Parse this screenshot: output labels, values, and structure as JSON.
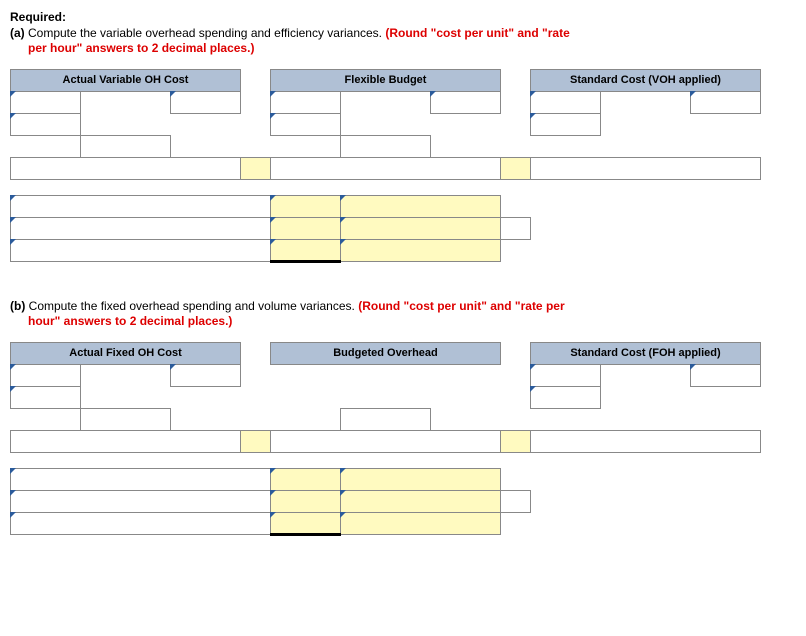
{
  "required_label": "Required:",
  "partA": {
    "marker": "(a) ",
    "text_main": "Compute the variable overhead spending and efficiency variances. ",
    "text_red1": "(Round \"cost per unit\" and \"rate",
    "text_red2": "per hour\" answers to 2 decimal places.)",
    "headers": {
      "col1": "Actual Variable OH Cost",
      "col2": "Flexible Budget",
      "col3": "Standard Cost (VOH applied)"
    }
  },
  "partB": {
    "marker": "(b) ",
    "text_main": "Compute the fixed overhead spending and volume variances. ",
    "text_red1": "(Round \"cost per unit\" and \"rate per",
    "text_red2": "hour\" answers to 2 decimal places.)",
    "headers": {
      "col1": "Actual Fixed OH Cost",
      "col2": "Budgeted Overhead",
      "col3": "Standard Cost (FOH applied)"
    }
  }
}
